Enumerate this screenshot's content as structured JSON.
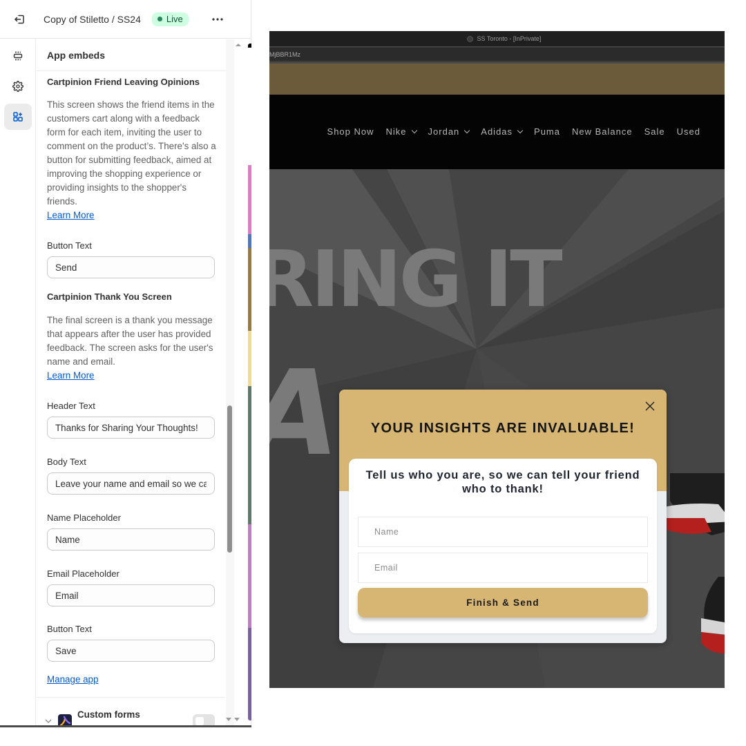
{
  "topbar": {
    "store_title": "Copy of Stiletto / SS24",
    "status_badge": "Live",
    "more_label": "•••"
  },
  "rail": {
    "items": [
      {
        "icon": "sections-icon",
        "active": false
      },
      {
        "icon": "gear-icon",
        "active": false
      },
      {
        "icon": "app-embeds-icon",
        "active": true
      }
    ]
  },
  "panel": {
    "header": "App embeds",
    "friend_section": {
      "title": "Cartpinion Friend Leaving Opinions",
      "description": "This screen shows the friend items in the customers cart along with a feedback form for each item, inviting the user to comment on the product’s. There's also a button for submitting feedback, aimed at improving the shopping experience or providing insights to the shopper's friends.",
      "learn_more": "Learn More",
      "button_text_label": "Button Text",
      "button_text_value": "Send"
    },
    "thank_you_section": {
      "title": "Cartpinion Thank You Screen",
      "description": "The final screen is a thank you message that appears after the user has provided feedback. The screen asks for the user's name and email.",
      "learn_more": "Learn More",
      "fields": [
        {
          "label": "Header Text",
          "value": "Thanks for Sharing Your Thoughts!"
        },
        {
          "label": "Body Text",
          "value": "Leave your name and email so we can let your friend know who to thank!"
        },
        {
          "label": "Name Placeholder",
          "value": "Name"
        },
        {
          "label": "Email Placeholder",
          "value": "Email"
        },
        {
          "label": "Button Text",
          "value": "Save"
        }
      ]
    },
    "manage_app": "Manage app",
    "next_app": {
      "name": "Custom forms",
      "enabled": false
    }
  },
  "browser": {
    "window_title": "SS Toronto - [InPrivate]",
    "url_fragment": "MjBBR1Mz",
    "nav_items": [
      {
        "label": "Shop Now",
        "dropdown": false
      },
      {
        "label": "Nike",
        "dropdown": true
      },
      {
        "label": "Jordan",
        "dropdown": true
      },
      {
        "label": "Adidas",
        "dropdown": true
      },
      {
        "label": "Puma",
        "dropdown": false
      },
      {
        "label": "New Balance",
        "dropdown": false
      },
      {
        "label": "Sale",
        "dropdown": false
      },
      {
        "label": "Used",
        "dropdown": false
      }
    ],
    "hero_text_line1": "RING IT",
    "hero_text_line2": "A"
  },
  "modal": {
    "title": "YOUR INSIGHTS ARE INVALUABLE!",
    "subtitle": "Tell us who you are, so we can tell your friend who to thank!",
    "name_placeholder": "Name",
    "email_placeholder": "Email",
    "submit_label": "Finish & Send",
    "accent_color": "#d7b572"
  },
  "colors": {
    "link": "#005bd3",
    "live_badge_bg": "#cdfee1",
    "live_dot": "#29845a",
    "announcement_bar": "#6b5b3a"
  }
}
